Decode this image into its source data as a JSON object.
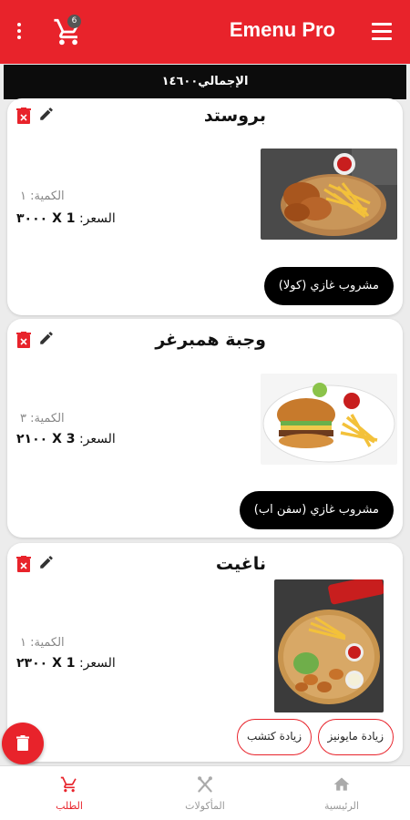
{
  "app": {
    "title": "Emenu Pro",
    "cart_count": "6",
    "icons": {
      "overflow": "more-vert-icon",
      "cart": "cart-icon",
      "menu": "hamburger-icon"
    }
  },
  "total": {
    "label": "الإجمالي١٤٦٠٠"
  },
  "colors": {
    "primary": "#e8232b",
    "dark": "#0c0c0c",
    "muted": "#888888"
  },
  "orders": [
    {
      "name": "بروستد",
      "qty": "الكمية: ١",
      "price_label": "السعر:",
      "price_value": "1 X ٣٠٠٠",
      "image": "fried-chicken-fries-photo",
      "extras": [
        "مشروب غازي (كولا)"
      ]
    },
    {
      "name": "وجبة همبرغر",
      "qty": "الكمية: ٣",
      "price_label": "السعر:",
      "price_value": "3 X ٢١٠٠",
      "image": "burger-fries-photo",
      "extras": [
        "مشروب غازي (سفن اب)"
      ]
    },
    {
      "name": "ناغيت",
      "qty": "الكمية: ١",
      "price_label": "السعر:",
      "price_value": "1 X ٢٣٠٠",
      "image": "nuggets-platter-photo",
      "extras": [
        "زيادة مايونيز",
        "زيادة كتشب"
      ]
    }
  ],
  "nav": [
    {
      "label": "الطلب",
      "icon": "cart-icon",
      "active": true
    },
    {
      "label": "المأكولات",
      "icon": "fork-knife-icon",
      "active": false
    },
    {
      "label": "الرئيسية",
      "icon": "home-icon",
      "active": false
    }
  ]
}
